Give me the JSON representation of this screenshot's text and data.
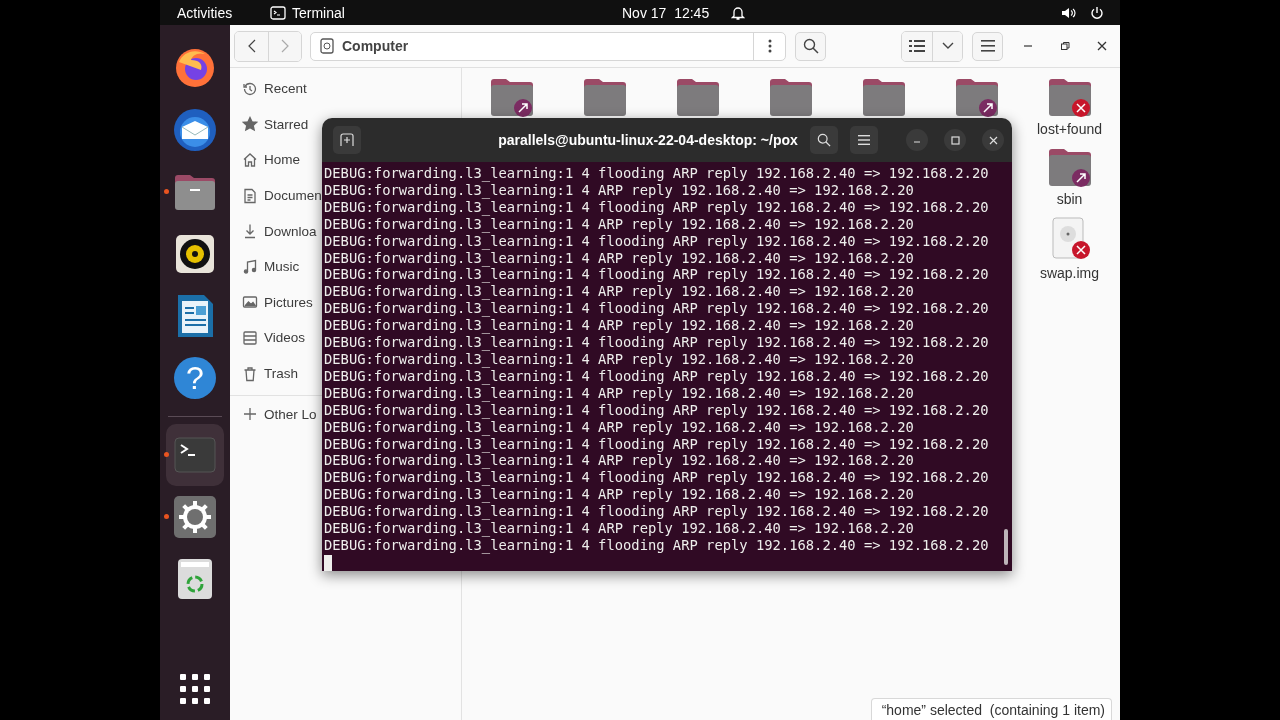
{
  "top_bar": {
    "activities": "Activities",
    "app": "Terminal",
    "clock": "Nov 17  12:45"
  },
  "dock": [
    {
      "kind": "browser",
      "running": false,
      "focused": false
    },
    {
      "kind": "mail",
      "running": false,
      "focused": false
    },
    {
      "kind": "files",
      "running": true,
      "focused": false
    },
    {
      "kind": "music",
      "running": false,
      "focused": false
    },
    {
      "kind": "writer",
      "running": false,
      "focused": false
    },
    {
      "kind": "help",
      "glyph": "?",
      "running": false,
      "focused": false
    },
    {
      "kind": "terminal",
      "running": true,
      "focused": true
    },
    {
      "kind": "settings",
      "running": true,
      "focused": false
    },
    {
      "kind": "trash",
      "running": false,
      "focused": false
    }
  ],
  "files": {
    "path": "Computer",
    "sidebar": [
      {
        "kind": "recent",
        "label": "Recent"
      },
      {
        "kind": "starred",
        "label": "Starred"
      },
      {
        "kind": "home",
        "label": "Home"
      },
      {
        "kind": "documents",
        "label": "Documen"
      },
      {
        "kind": "downloads",
        "label": "Downloa"
      },
      {
        "kind": "music",
        "label": "Music"
      },
      {
        "kind": "pictures",
        "label": "Pictures"
      },
      {
        "kind": "videos",
        "label": "Videos"
      },
      {
        "kind": "trash",
        "label": "Trash"
      },
      {
        "kind": "other",
        "label": "Other Lo"
      }
    ],
    "items": [
      {
        "kind": "folder",
        "symlink": true,
        "no_access": false
      },
      {
        "kind": "folder",
        "symlink": false,
        "no_access": false
      },
      {
        "kind": "folder",
        "symlink": false,
        "no_access": false
      },
      {
        "kind": "folder",
        "symlink": false,
        "no_access": false
      },
      {
        "kind": "folder",
        "symlink": false,
        "no_access": false
      },
      {
        "kind": "folder",
        "symlink": true,
        "no_access": false
      },
      {
        "kind": "folder",
        "symlink": false,
        "no_access": true,
        "name": "lost+found"
      },
      {
        "kind": "folder",
        "symlink": true,
        "no_access": false,
        "name": "sbin"
      },
      {
        "kind": "disk-file",
        "symlink": false,
        "no_access": true,
        "name": "swap.img"
      }
    ],
    "status": "“home” selected  (containing 1 item)"
  },
  "terminal": {
    "title": "parallels@ubuntu-linux-22-04-desktop: ~/pox",
    "lines": [
      "DEBUG:forwarding.l3_learning:1 4 flooding ARP reply 192.168.2.40 => 192.168.2.20",
      "DEBUG:forwarding.l3_learning:1 4 ARP reply 192.168.2.40 => 192.168.2.20",
      "DEBUG:forwarding.l3_learning:1 4 flooding ARP reply 192.168.2.40 => 192.168.2.20",
      "DEBUG:forwarding.l3_learning:1 4 ARP reply 192.168.2.40 => 192.168.2.20",
      "DEBUG:forwarding.l3_learning:1 4 flooding ARP reply 192.168.2.40 => 192.168.2.20",
      "DEBUG:forwarding.l3_learning:1 4 ARP reply 192.168.2.40 => 192.168.2.20",
      "DEBUG:forwarding.l3_learning:1 4 flooding ARP reply 192.168.2.40 => 192.168.2.20",
      "DEBUG:forwarding.l3_learning:1 4 ARP reply 192.168.2.40 => 192.168.2.20",
      "DEBUG:forwarding.l3_learning:1 4 flooding ARP reply 192.168.2.40 => 192.168.2.20",
      "DEBUG:forwarding.l3_learning:1 4 ARP reply 192.168.2.40 => 192.168.2.20",
      "DEBUG:forwarding.l3_learning:1 4 flooding ARP reply 192.168.2.40 => 192.168.2.20",
      "DEBUG:forwarding.l3_learning:1 4 ARP reply 192.168.2.40 => 192.168.2.20",
      "DEBUG:forwarding.l3_learning:1 4 flooding ARP reply 192.168.2.40 => 192.168.2.20",
      "DEBUG:forwarding.l3_learning:1 4 ARP reply 192.168.2.40 => 192.168.2.20",
      "DEBUG:forwarding.l3_learning:1 4 flooding ARP reply 192.168.2.40 => 192.168.2.20",
      "DEBUG:forwarding.l3_learning:1 4 ARP reply 192.168.2.40 => 192.168.2.20",
      "DEBUG:forwarding.l3_learning:1 4 flooding ARP reply 192.168.2.40 => 192.168.2.20",
      "DEBUG:forwarding.l3_learning:1 4 ARP reply 192.168.2.40 => 192.168.2.20",
      "DEBUG:forwarding.l3_learning:1 4 flooding ARP reply 192.168.2.40 => 192.168.2.20",
      "DEBUG:forwarding.l3_learning:1 4 ARP reply 192.168.2.40 => 192.168.2.20",
      "DEBUG:forwarding.l3_learning:1 4 flooding ARP reply 192.168.2.40 => 192.168.2.20",
      "DEBUG:forwarding.l3_learning:1 4 ARP reply 192.168.2.40 => 192.168.2.20",
      "DEBUG:forwarding.l3_learning:1 4 flooding ARP reply 192.168.2.40 => 192.168.2.20"
    ]
  }
}
